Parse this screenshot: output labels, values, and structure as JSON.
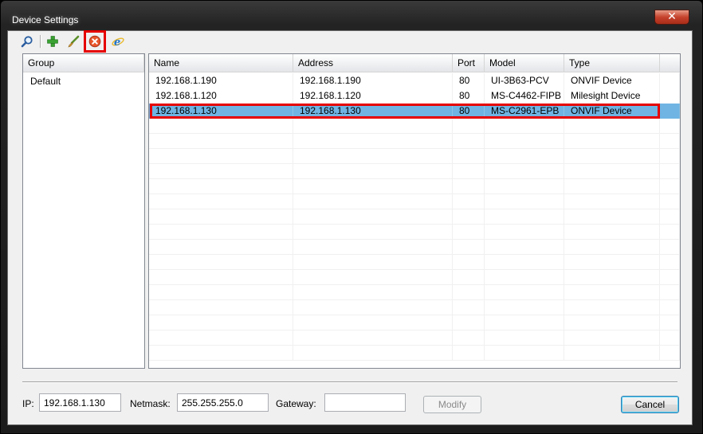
{
  "window": {
    "title": "Device Settings",
    "close_glyph": "✕"
  },
  "toolbar": {
    "icons": [
      "search-icon",
      "add-icon",
      "edit-icon",
      "delete-icon",
      "browser-icon"
    ],
    "highlighted": "delete-icon"
  },
  "groups": {
    "header": "Group",
    "items": [
      "Default"
    ]
  },
  "devices": {
    "columns": [
      "Name",
      "Address",
      "Port",
      "Model",
      "Type"
    ],
    "rows": [
      [
        "192.168.1.190",
        "192.168.1.190",
        "80",
        "UI-3B63-PCV",
        "ONVIF Device"
      ],
      [
        "192.168.1.120",
        "192.168.1.120",
        "80",
        "MS-C4462-FIPB",
        "Milesight Device"
      ],
      [
        "192.168.1.130",
        "192.168.1.130",
        "80",
        "MS-C2961-EPB",
        "ONVIF Device"
      ]
    ],
    "selected_index": 2
  },
  "network": {
    "ip_label": "IP:",
    "ip_value": "192.168.1.130",
    "netmask_label": "Netmask:",
    "netmask_value": "255.255.255.0",
    "gateway_label": "Gateway:",
    "gateway_value": ""
  },
  "buttons": {
    "modify": "Modify",
    "cancel": "Cancel"
  },
  "colors": {
    "selection": "#6fb4e3",
    "highlight": "#e60000",
    "close_button": "#c6422d"
  }
}
